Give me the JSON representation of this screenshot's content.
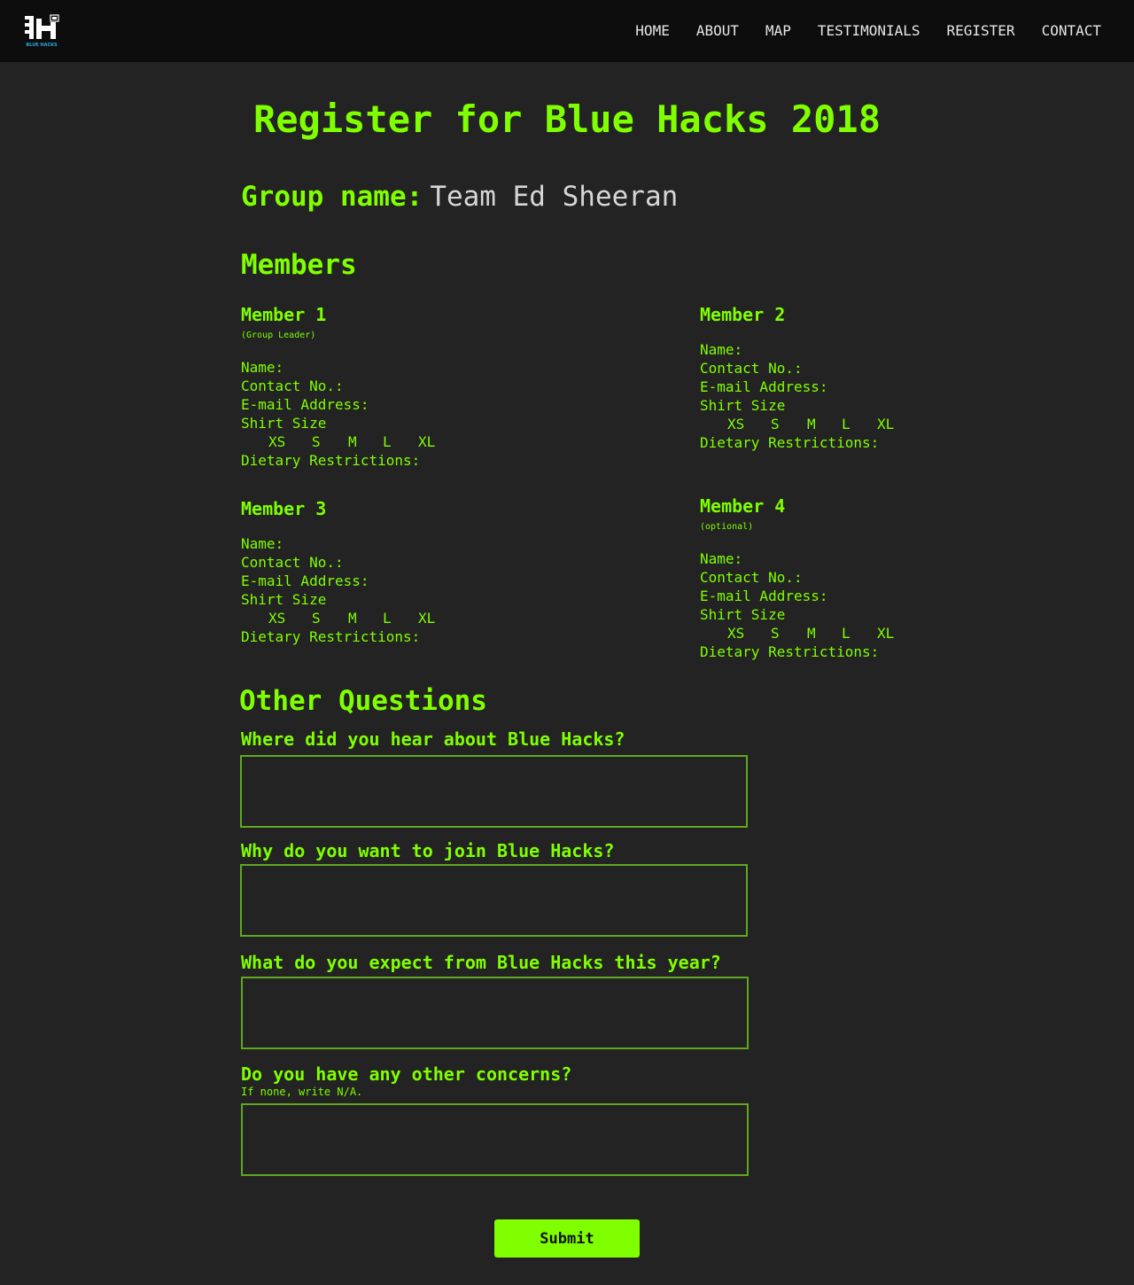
{
  "nav": {
    "logo_text": "BLUE HACKS",
    "links": [
      "HOME",
      "ABOUT",
      "MAP",
      "TESTIMONIALS",
      "REGISTER",
      "CONTACT"
    ]
  },
  "page": {
    "title": "Register for Blue Hacks 2018"
  },
  "group": {
    "label": "Group name:",
    "value": "Team Ed Sheeran"
  },
  "members_heading": "Members",
  "members": [
    {
      "title": "Member 1",
      "note": "(Group Leader)",
      "name_label": "Name:",
      "contact_label": "Contact No.:",
      "email_label": "E-mail Address:",
      "shirt_label": "Shirt Size",
      "sizes": [
        "XS",
        "S",
        "M",
        "L",
        "XL"
      ],
      "diet_label": "Dietary Restrictions:"
    },
    {
      "title": "Member 2",
      "note": "",
      "name_label": "Name:",
      "contact_label": "Contact No.:",
      "email_label": "E-mail Address:",
      "shirt_label": "Shirt Size",
      "sizes": [
        "XS",
        "S",
        "M",
        "L",
        "XL"
      ],
      "diet_label": "Dietary Restrictions:"
    },
    {
      "title": "Member 3",
      "note": "",
      "name_label": "Name:",
      "contact_label": "Contact No.:",
      "email_label": "E-mail Address:",
      "shirt_label": "Shirt Size",
      "sizes": [
        "XS",
        "S",
        "M",
        "L",
        "XL"
      ],
      "diet_label": "Dietary Restrictions:"
    },
    {
      "title": "Member 4",
      "note": "(optional)",
      "name_label": "Name:",
      "contact_label": "Contact No.:",
      "email_label": "E-mail Address:",
      "shirt_label": "Shirt Size",
      "sizes": [
        "XS",
        "S",
        "M",
        "L",
        "XL"
      ],
      "diet_label": "Dietary Restrictions:"
    }
  ],
  "other_heading": "Other Questions",
  "questions": [
    {
      "label": "Where did you hear about Blue Hacks?",
      "hint": "",
      "value": ""
    },
    {
      "label": "Why do you want to join Blue Hacks?",
      "hint": "",
      "value": ""
    },
    {
      "label": "What do you expect from Blue Hacks this year?",
      "hint": "",
      "value": ""
    },
    {
      "label": "Do you have any other concerns?",
      "hint": "If none, write N/A.",
      "value": ""
    }
  ],
  "submit_label": "Submit",
  "colors": {
    "accent": "#7fff00",
    "background": "#232323",
    "navbar": "#0d0d0d",
    "nav_text": "#e6e6e6",
    "input_border": "#5fa81f"
  }
}
